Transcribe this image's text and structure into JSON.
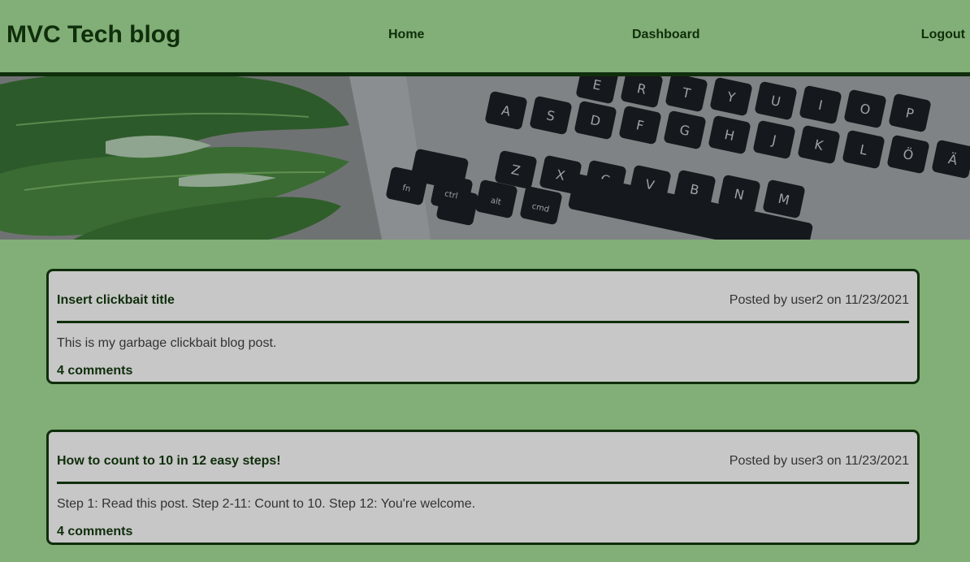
{
  "header": {
    "brand": "MVC Tech blog",
    "nav": {
      "home": "Home",
      "dashboard": "Dashboard",
      "logout": "Logout"
    }
  },
  "hero": {
    "keys_row1": [
      "E",
      "R",
      "T",
      "Y",
      "U",
      "I",
      "O",
      "P"
    ],
    "keys_row2": [
      "A",
      "S",
      "D",
      "F",
      "G",
      "H",
      "J",
      "K",
      "L",
      "Ö",
      "Ä"
    ],
    "keys_row3": [
      "Z",
      "X",
      "C",
      "V",
      "B",
      "N",
      "M"
    ],
    "mod_keys": [
      "fn",
      "ctrl",
      "alt",
      "cmd"
    ]
  },
  "posts": [
    {
      "title": "Insert clickbait title",
      "meta": "Posted by user2 on 11/23/2021",
      "body": "This is my garbage clickbait blog post.",
      "comments": "4 comments"
    },
    {
      "title": "How to count to 10 in 12 easy steps!",
      "meta": "Posted by user3 on 11/23/2021",
      "body": "Step 1: Read this post. Step 2-11: Count to 10. Step 12: You're welcome.",
      "comments": "4 comments"
    }
  ],
  "colors": {
    "page_bg": "#82ae77",
    "accent": "#0f2e0b",
    "card_bg": "#c7c7c7"
  }
}
